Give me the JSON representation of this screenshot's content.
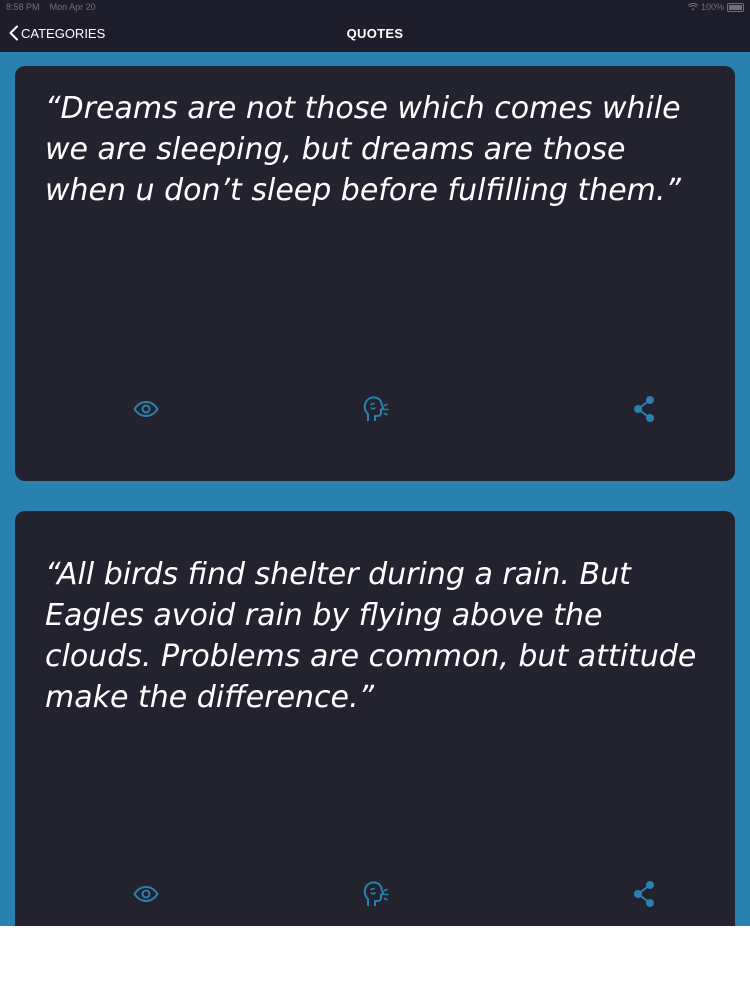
{
  "status_bar": {
    "time": "8:58 PM",
    "date": "Mon Apr 20",
    "battery": "100%"
  },
  "nav": {
    "back_label": "CATEGORIES",
    "title": "QUOTES"
  },
  "quotes": [
    {
      "text": "“Dreams are not those which comes while we are sleeping, but dreams are those when u don’t sleep before fulfilling them.”",
      "actions": [
        "eye-icon",
        "speak-icon",
        "share-icon"
      ]
    },
    {
      "text": "“All birds find shelter during a rain. But Eagles avoid rain by flying above the clouds. Problems are common, but attitude make the difference.”",
      "actions": [
        "eye-icon",
        "speak-icon",
        "share-icon"
      ]
    }
  ],
  "colors": {
    "background": "#2a80ae",
    "card": "#23222f",
    "navbar": "#1e1d2b",
    "icon_accent": "#2a80ae",
    "text": "#ffffff"
  }
}
